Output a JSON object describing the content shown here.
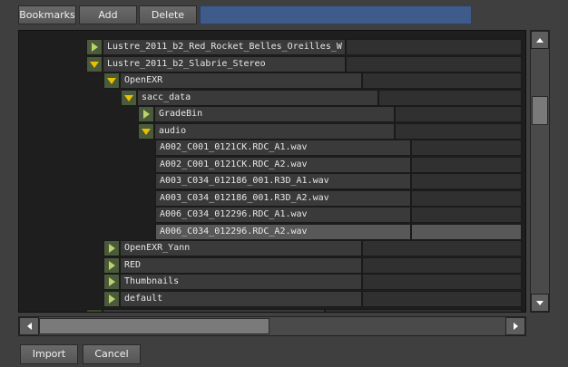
{
  "toolbar": {
    "bookmarks_label": "Bookmarks",
    "add_label": "Add",
    "delete_label": "Delete",
    "path_value": ""
  },
  "tree": {
    "rows": [
      {
        "label": "Lustre_2011_b2_Red_Rocket_Belles_Oreilles_W",
        "level": 0,
        "toggle": "collapsed"
      },
      {
        "label": "Lustre_2011_b2_Slabrie_Stereo",
        "level": 0,
        "toggle": "expanded"
      },
      {
        "label": "OpenEXR",
        "level": 1,
        "toggle": "expanded"
      },
      {
        "label": "sacc_data",
        "level": 2,
        "toggle": "expanded"
      },
      {
        "label": "GradeBin",
        "level": 3,
        "toggle": "collapsed"
      },
      {
        "label": "audio",
        "level": 3,
        "toggle": "expanded"
      },
      {
        "label": "A002_C001_0121CK.RDC_A1.wav",
        "level": 4,
        "toggle": "none"
      },
      {
        "label": "A002_C001_0121CK.RDC_A2.wav",
        "level": 4,
        "toggle": "none"
      },
      {
        "label": "A003_C034_012186_001.R3D_A1.wav",
        "level": 4,
        "toggle": "none"
      },
      {
        "label": "A003_C034_012186_001.R3D_A2.wav",
        "level": 4,
        "toggle": "none"
      },
      {
        "label": "A006_C034_012296.RDC_A1.wav",
        "level": 4,
        "toggle": "none"
      },
      {
        "label": "A006_C034_012296.RDC_A2.wav",
        "level": 4,
        "toggle": "none",
        "selected": true
      },
      {
        "label": "OpenEXR_Yann",
        "level": 1,
        "toggle": "collapsed"
      },
      {
        "label": "RED",
        "level": 1,
        "toggle": "collapsed"
      },
      {
        "label": "Thumbnails",
        "level": 1,
        "toggle": "collapsed"
      },
      {
        "label": "default",
        "level": 1,
        "toggle": "collapsed"
      }
    ]
  },
  "footer": {
    "import_label": "Import",
    "cancel_label": "Cancel"
  },
  "scroll": {
    "vertical_position": 0.22,
    "horizontal_position": 0.0
  },
  "icons": {
    "collapsed": "triangle-right-icon",
    "expanded": "triangle-down-icon"
  },
  "colors": {
    "path_field": "#3e5b8a",
    "expand_arrow": "#e8c000",
    "collapse_arrow": "#b9d46a"
  }
}
